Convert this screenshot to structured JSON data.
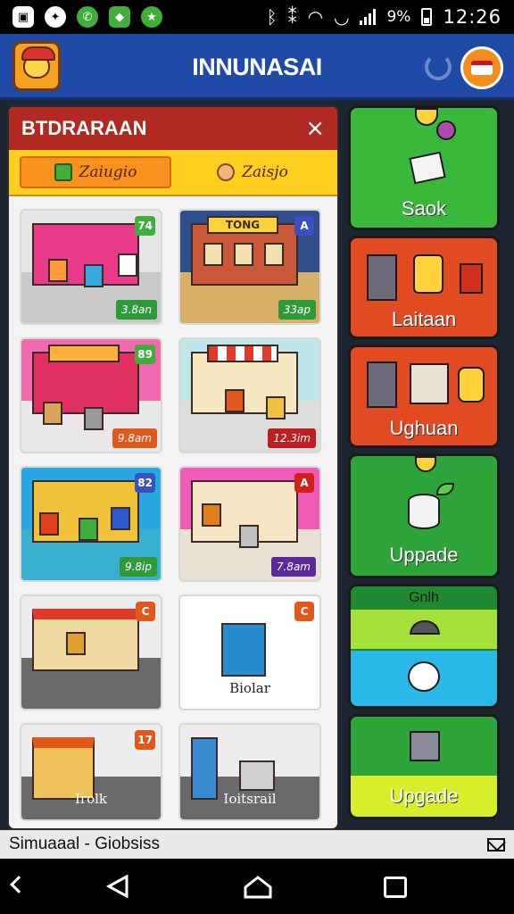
{
  "status_bar": {
    "battery": "9%",
    "time": "12:26"
  },
  "header": {
    "title": "INNUNASAI"
  },
  "panel": {
    "title": "BTDRARAAN",
    "close_glyph": "×",
    "tabs": [
      {
        "label": "Zaiugio",
        "active": true
      },
      {
        "label": "Zaisjo",
        "active": false
      }
    ],
    "cards": [
      {
        "badge": "74",
        "price": "3.8an",
        "sign": "",
        "label": "",
        "theme": "pink"
      },
      {
        "badge": "A",
        "price": "33ap",
        "sign": "TONG",
        "label": "",
        "theme": "brown"
      },
      {
        "badge": "89",
        "price": "9.8am",
        "sign": "",
        "label": "",
        "theme": "magenta"
      },
      {
        "badge": "",
        "price": "12.3im",
        "sign": "",
        "label": "",
        "theme": "mint"
      },
      {
        "badge": "82",
        "price": "9.8ip",
        "sign": "",
        "label": "",
        "theme": "cyan"
      },
      {
        "badge": "A",
        "price": "7.8am",
        "sign": "",
        "label": "",
        "theme": "hotpink"
      },
      {
        "badge": "C",
        "price": "",
        "sign": "",
        "label": "",
        "theme": "grey"
      },
      {
        "badge": "C",
        "price": "",
        "sign": "",
        "label": "Biolar",
        "theme": "white"
      },
      {
        "badge": "17",
        "price": "",
        "sign": "",
        "label": "Irolk",
        "theme": "grey"
      },
      {
        "badge": "",
        "price": "",
        "sign": "",
        "label": "Ioitsrail",
        "theme": "grey"
      }
    ]
  },
  "sidebar": {
    "btn1": "Saok",
    "btn2": "Laitaan",
    "btn3": "Ughuan",
    "btn4": "Uppade",
    "group_title": "Gnlh",
    "btn6": "Upgade"
  },
  "footer": {
    "text": "Simuaaal - Giobsiss"
  },
  "colors": {
    "header": "#1f4aa8",
    "panel_head": "#b02a22",
    "tabbar": "#ffcf1f",
    "green": "#35b33a",
    "red_orange": "#e24b22"
  }
}
